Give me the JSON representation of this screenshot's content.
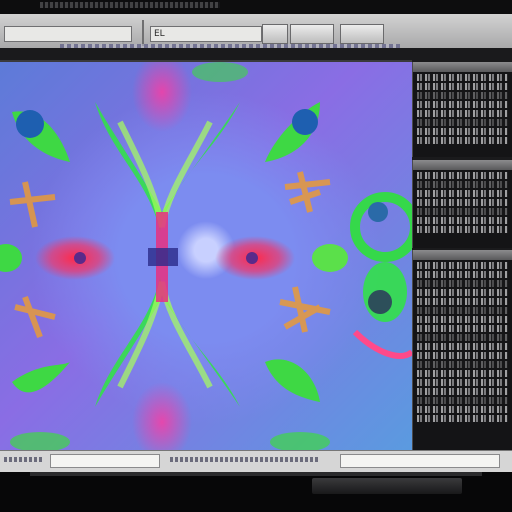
{
  "toolbar": {
    "field_1": "",
    "field_2": "EL",
    "button_1": "",
    "button_2": "",
    "button_3": ""
  },
  "canvas": {
    "description_label": ""
  },
  "right_panel": {
    "top_header": "",
    "middle_header": "",
    "bottom_header": ""
  },
  "status_bar": {
    "field_1": "",
    "field_2": ""
  },
  "colors": {
    "toolbar_bg": "#c2c2c2",
    "canvas_blue": "#6e7fe0",
    "accent_green": "#38e23a",
    "accent_pink": "#e8307a",
    "panel_bg": "#141416"
  },
  "icons": [
    "window-strip-icon"
  ]
}
